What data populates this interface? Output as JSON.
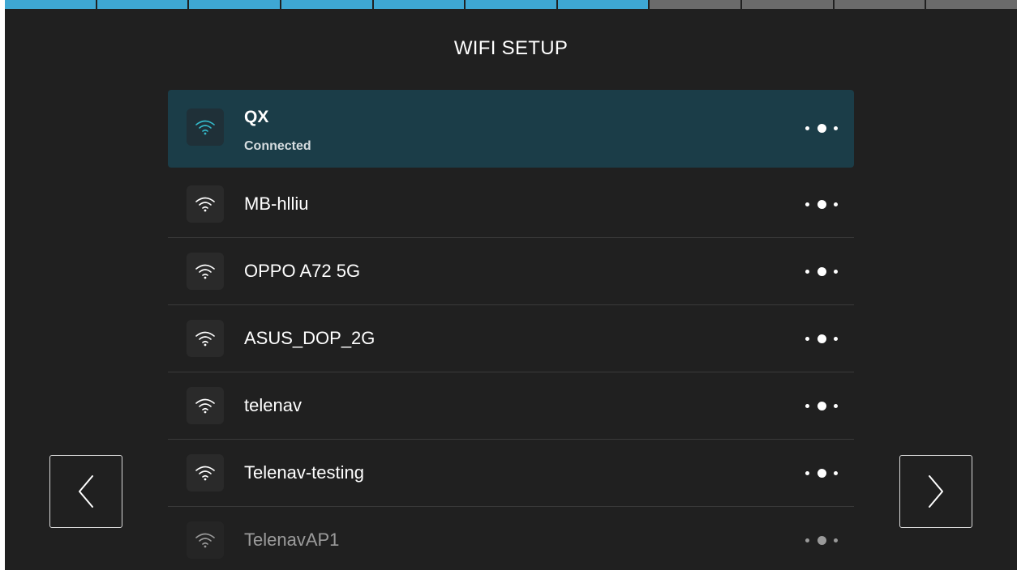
{
  "header": {
    "title": "WIFI SETUP",
    "progress": {
      "total_steps": 11,
      "active_steps": 7
    }
  },
  "colors": {
    "background": "#202020",
    "accent": "#3ea7d3",
    "connected_row": "#1b3d48",
    "connected_icon": "#34b9c9"
  },
  "networks": [
    {
      "ssid": "QX",
      "status": "Connected",
      "icon": "wifi-icon",
      "menu_icon": "more-dots-icon"
    },
    {
      "ssid": "MB-hlliu",
      "icon": "wifi-icon",
      "menu_icon": "more-dots-icon"
    },
    {
      "ssid": "OPPO A72 5G",
      "icon": "wifi-icon",
      "menu_icon": "more-dots-icon"
    },
    {
      "ssid": "ASUS_DOP_2G",
      "icon": "wifi-icon",
      "menu_icon": "more-dots-icon"
    },
    {
      "ssid": "telenav",
      "icon": "wifi-icon",
      "menu_icon": "more-dots-icon"
    },
    {
      "ssid": "Telenav-testing",
      "icon": "wifi-icon",
      "menu_icon": "more-dots-icon"
    },
    {
      "ssid": "TelenavAP1",
      "icon": "wifi-icon",
      "menu_icon": "more-dots-icon"
    }
  ],
  "navigation": {
    "prev_icon": "chevron-left-icon",
    "next_icon": "chevron-right-icon"
  }
}
